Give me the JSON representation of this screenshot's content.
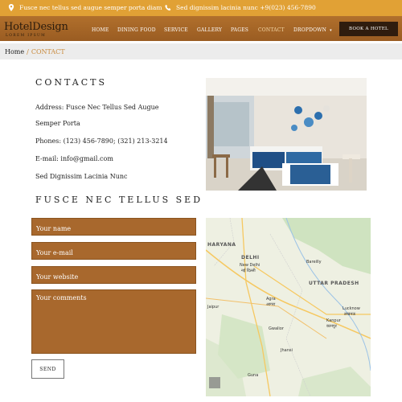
{
  "topbar": {
    "address": "Fusce nec tellus sed augue semper porta diam",
    "phone": "Sed dignissim lacinia nunc +9(023) 456-7890"
  },
  "brand": {
    "name": "HotelDesign",
    "tagline": "LOREM IPSUM"
  },
  "nav": {
    "items": [
      "HOME",
      "DINING FOOD",
      "SERVICE",
      "GALLERY",
      "PAGES",
      "CONTACT",
      "DROPDOWN"
    ],
    "active": "CONTACT",
    "book_label": "BOOK A HOTEL"
  },
  "breadcrumb": {
    "home": "Home",
    "separator": "/",
    "current": "CONTACT"
  },
  "contacts": {
    "heading": "CONTACTS",
    "address_line1": "Address: Fusce Nec Tellus Sed Augue",
    "address_line2": "Semper Porta",
    "phones": "Phones: (123) 456-7890; (321) 213-3214",
    "email": "E-mail: info@gmail.com",
    "note": "Sed Dignissim Lacinia Nunc"
  },
  "form": {
    "heading": "FUSCE NEC TELLUS SED",
    "name_placeholder": "Your name",
    "email_placeholder": "Your e-mail",
    "website_placeholder": "Your website",
    "comments_placeholder": "Your comments",
    "send_label": "SEND"
  },
  "map": {
    "labels": {
      "haryana": "HARYANA",
      "delhi": "DELHI",
      "new_delhi": "New Delhi",
      "new_delhi_hi": "नई दिल्ली",
      "uttar_pradesh": "UTTAR PRADESH",
      "agra": "Agra",
      "agra_hi": "आगरा",
      "gwalior": "Gwalior",
      "lucknow": "Lucknow",
      "lucknow_hi": "लखनऊ",
      "kanpur": "Kanpur",
      "kanpur_hi": "कानपुर",
      "jaipur": "Jaipur",
      "bareilly": "Bareilly",
      "jhansi": "Jhansi",
      "guna": "Guna"
    }
  },
  "colors": {
    "topbar": "#e1a135",
    "navbar": "#a8672a",
    "book_button": "#2f1c0e",
    "field_bg": "#a8682d",
    "accent_text": "#c98a3c"
  }
}
